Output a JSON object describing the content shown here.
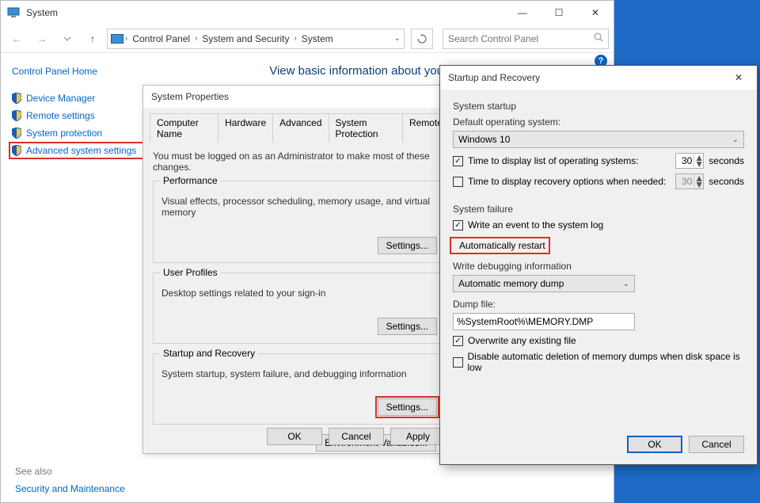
{
  "system_window": {
    "title": "System",
    "breadcrumb": [
      "Control Panel",
      "System and Security",
      "System"
    ],
    "search_placeholder": "Search Control Panel",
    "home": "Control Panel Home",
    "links": [
      {
        "label": "Device Manager"
      },
      {
        "label": "Remote settings"
      },
      {
        "label": "System protection"
      },
      {
        "label": "Advanced system settings"
      }
    ],
    "heading": "View basic information about your computer",
    "see_also": "See also",
    "see_also_link": "Security and Maintenance"
  },
  "props_dialog": {
    "title": "System Properties",
    "tabs": [
      "Computer Name",
      "Hardware",
      "Advanced",
      "System Protection",
      "Remote"
    ],
    "active_tab": "Advanced",
    "intro": "You must be logged on as an Administrator to make most of these changes.",
    "groups": {
      "perf": {
        "legend": "Performance",
        "desc": "Visual effects, processor scheduling, memory usage, and virtual memory",
        "btn": "Settings..."
      },
      "prof": {
        "legend": "User Profiles",
        "desc": "Desktop settings related to your sign-in",
        "btn": "Settings..."
      },
      "sr": {
        "legend": "Startup and Recovery",
        "desc": "System startup, system failure, and debugging information",
        "btn": "Settings..."
      }
    },
    "env_btn": "Environment Variables...",
    "ok": "OK",
    "cancel": "Cancel",
    "apply": "Apply"
  },
  "sr_dialog": {
    "title": "Startup and Recovery",
    "startup": {
      "section": "System startup",
      "default_label": "Default operating system:",
      "default_value": "Windows 10",
      "time_os_label": "Time to display list of operating systems:",
      "time_os_value": "30",
      "time_rec_label": "Time to display recovery options when needed:",
      "time_rec_value": "30",
      "seconds": "seconds"
    },
    "failure": {
      "section": "System failure",
      "write_event": "Write an event to the system log",
      "auto_restart": "Automatically restart",
      "write_dbg_label": "Write debugging information",
      "write_dbg_value": "Automatic memory dump",
      "dump_label": "Dump file:",
      "dump_value": "%SystemRoot%\\MEMORY.DMP",
      "overwrite": "Overwrite any existing file",
      "disable_del": "Disable automatic deletion of memory dumps when disk space is low"
    },
    "ok": "OK",
    "cancel": "Cancel"
  }
}
